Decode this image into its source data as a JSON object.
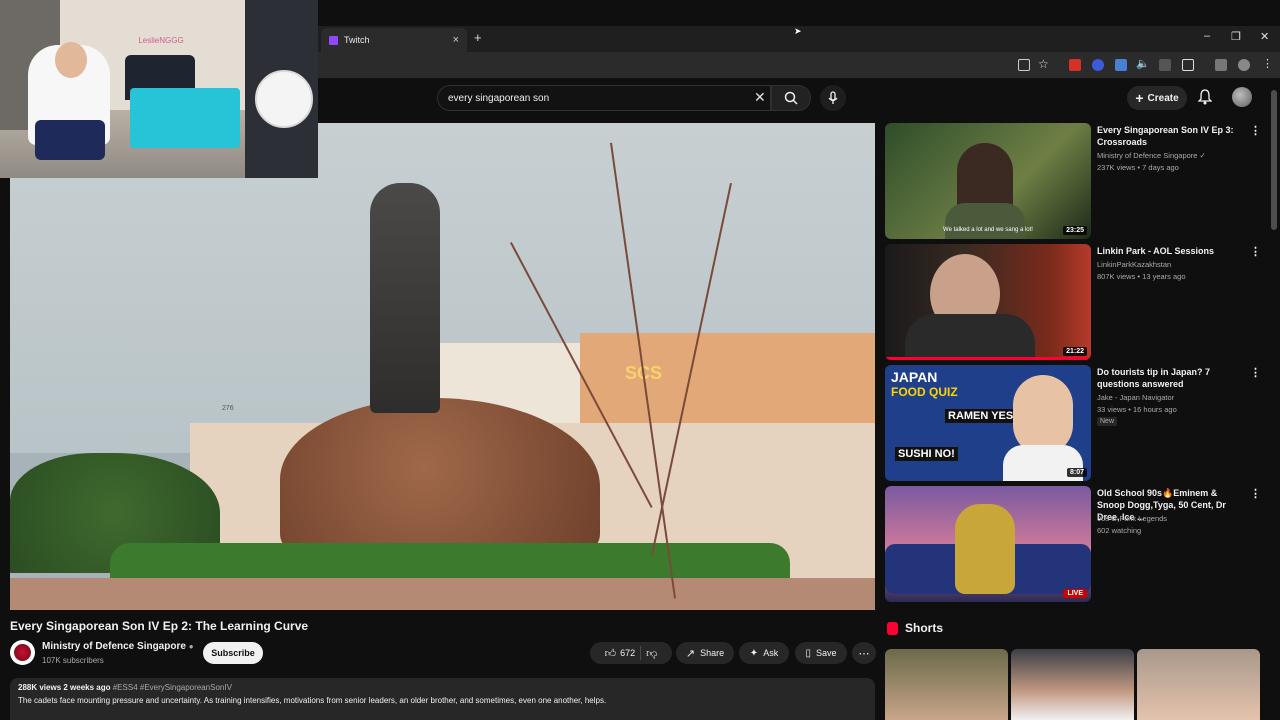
{
  "browser": {
    "tab_title": "Twitch",
    "tab_close": "×",
    "new_tab": "+",
    "window_controls": [
      "–",
      "❐",
      "✕"
    ]
  },
  "webcam": {
    "logo_text": "LeslieNGGG"
  },
  "header": {
    "search_value": "every singaporean son",
    "create_label": "Create"
  },
  "video": {
    "title": "Every Singaporean Son IV Ep 2: The Learning Curve",
    "building_number": "276",
    "sign_text": "SCS",
    "channel_name": "Ministry of Defence Singapore",
    "channel_subs": "107K subscribers",
    "subscribe_label": "Subscribe",
    "likes": "672",
    "share_label": "Share",
    "ask_label": "Ask",
    "save_label": "Save",
    "desc_meta": "288K views  2 weeks ago",
    "desc_tags": "#ESS4 #EverySingaporeanSonIV",
    "desc_text": "The cadets face mounting pressure and uncertainty. As training intensifies, motivations from senior leaders, an older brother, and sometimes, even one another, helps."
  },
  "related": [
    {
      "title": "Every Singaporean Son IV Ep 3: Crossroads",
      "channel": "Ministry of Defence Singapore ✓",
      "views": "237K views • 7 days ago",
      "duration": "23:25",
      "caption": "We talked a lot and we sang a lot!"
    },
    {
      "title": "Linkin Park - AOL Sessions",
      "channel": "LinkinParkKazakhstan",
      "views": "807K views • 13 years ago",
      "duration": "21:22"
    },
    {
      "title": "Do tourists tip in Japan? 7 questions answered",
      "channel": "Jake - Japan Navigator",
      "views": "33 views • 16 hours ago",
      "duration": "8:07",
      "badge": "New",
      "thumb_text_1": "JAPAN",
      "thumb_text_2": "FOOD QUIZ",
      "thumb_text_3": "RAMEN YES!",
      "thumb_text_4": "SUSHI NO!"
    },
    {
      "title": "Old School 90s🔥Eminem & Snoop Dogg,Tyga, 50 Cent, Dr Dree, Ice ...",
      "channel": "90s G-Funk Legends",
      "views": "602 watching",
      "live_label": "LIVE"
    }
  ],
  "shorts": {
    "label": "Shorts"
  },
  "colors": {
    "accent_red": "#ff0033",
    "background": "#0f0f0f",
    "surface": "#272727"
  }
}
